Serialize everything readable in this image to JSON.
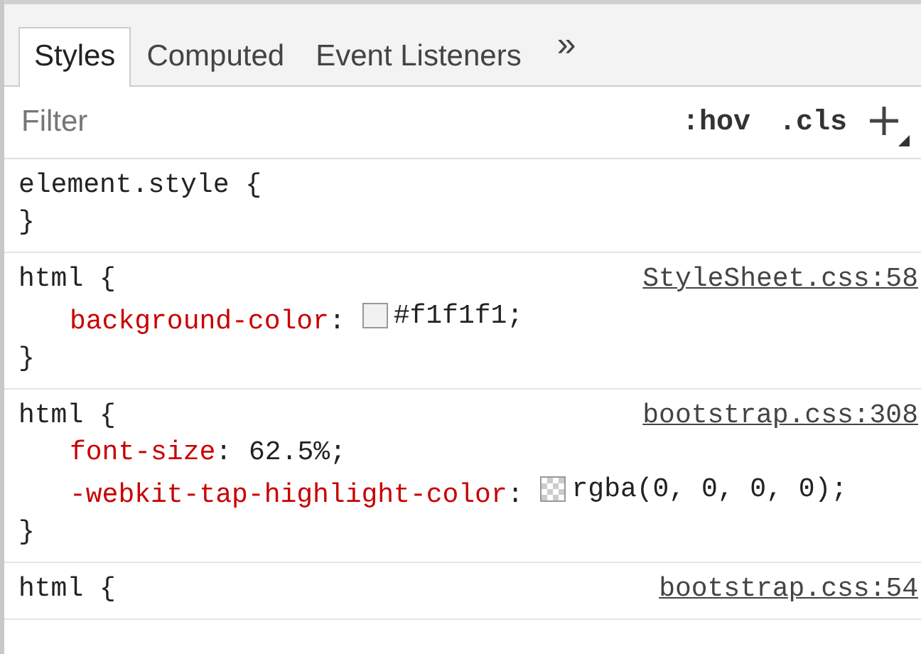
{
  "tabs": [
    {
      "label": "Styles",
      "selected": true
    },
    {
      "label": "Computed",
      "selected": false
    },
    {
      "label": "Event Listeners",
      "selected": false
    }
  ],
  "more_tabs": "»",
  "filter": {
    "placeholder": "Filter"
  },
  "toolbar": [
    ":hov",
    ".cls"
  ],
  "rules": [
    {
      "selector": "element.style {",
      "close": "}"
    },
    {
      "selector": "html {",
      "source": "StyleSheet.css:58",
      "declarations": [
        {
          "name": "background-color",
          "colon": ":",
          "value": "#f1f1f1;",
          "kind": "color"
        }
      ],
      "close": "}"
    },
    {
      "selector": "html {",
      "source": "bootstrap.css:308",
      "declarations": [
        {
          "name": "font-size",
          "colon": ":",
          "value": "62.5%;",
          "kind": "plain"
        },
        {
          "name": "-webkit-tap-highlight-color",
          "colon": ":",
          "value": "rgba(0, 0, 0, 0);",
          "kind": "transparent"
        }
      ],
      "close": "}"
    },
    {
      "selector": "html {",
      "source": "bootstrap.css:54"
    }
  ]
}
